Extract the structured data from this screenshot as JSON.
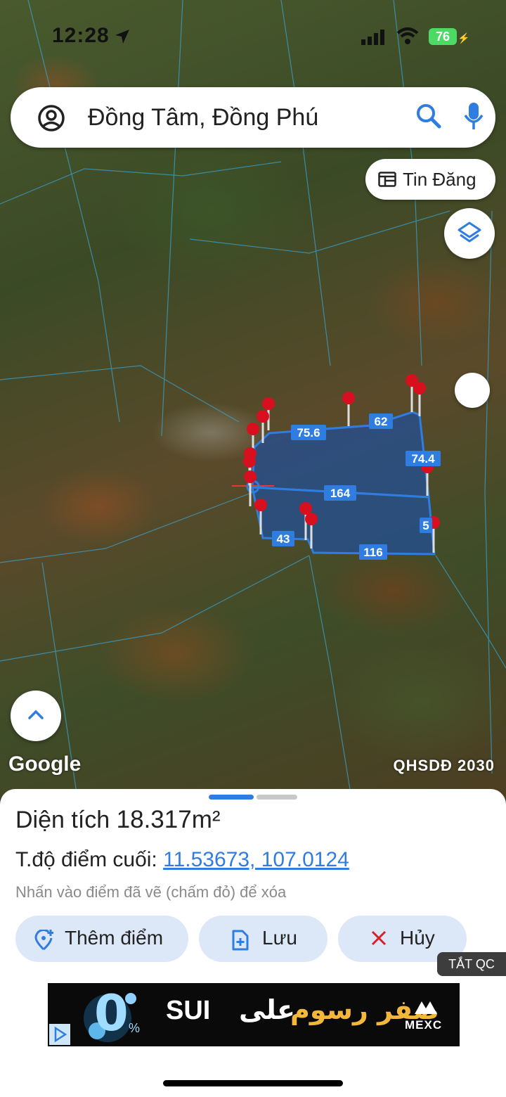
{
  "status_bar": {
    "time": "12:28",
    "battery": "76"
  },
  "search": {
    "query": "Đồng Tâm, Đồng Phú"
  },
  "map": {
    "tin_dang_label": "Tin Đăng",
    "google_label": "Google",
    "layer_label": "QHSDĐ 2030",
    "edge_labels": [
      "75.6",
      "62",
      "74.4",
      "164",
      "5",
      "43",
      "116"
    ]
  },
  "sheet": {
    "area_prefix": "Diện tích",
    "area_value": "18.317m²",
    "coord_prefix": "T.độ điểm cuối:",
    "coord_value": "11.53673, 107.0124",
    "hint": "Nhấn vào điểm đã vẽ (chấm đỏ) để xóa",
    "add_point_label": "Thêm điểm",
    "save_label": "Lưu",
    "cancel_label": "Hủy",
    "ad_close_label": "TẮT QC"
  },
  "ad": {
    "zero": "0",
    "percent": "%",
    "sui": "SUI",
    "arabic_white": "على",
    "arabic_gold": "صفر رسوم",
    "brand": "MEXC"
  },
  "colors": {
    "accent": "#2f7de1",
    "parcel_fill": "#1e4fa0",
    "pin": "#d80f1f",
    "button_bg": "#dce8f8"
  }
}
